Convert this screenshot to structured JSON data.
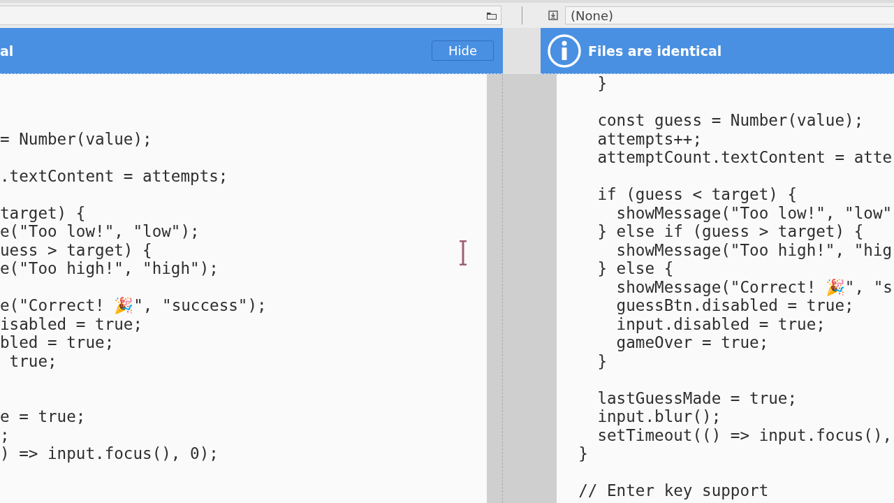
{
  "path_bar": {
    "left_path": {
      "kind": "field"
    },
    "right_path": {
      "value": "(None)"
    }
  },
  "left_pane": {
    "banner": {
      "title": "al",
      "button": "Hide"
    },
    "lines": [
      {
        "kind": "blank"
      },
      {
        "kind": "blank"
      },
      {
        "kind": "blank"
      },
      {
        "kind": "code",
        "text": "= Number(value);"
      },
      {
        "kind": "blank"
      },
      {
        "kind": "code",
        "text": ".textContent = attempts;"
      },
      {
        "kind": "blank"
      },
      {
        "kind": "code",
        "text": "target) {"
      },
      {
        "kind": "code",
        "text": "e(\"Too low!\", \"low\");"
      },
      {
        "kind": "code",
        "text": "uess > target) {"
      },
      {
        "kind": "code",
        "text": "e(\"Too high!\", \"high\");"
      },
      {
        "kind": "blank"
      },
      {
        "kind": "code",
        "text": "e(\"Correct! 🎉\", \"success\");"
      },
      {
        "kind": "code",
        "text": "isabled = true;"
      },
      {
        "kind": "code",
        "text": "bled = true;"
      },
      {
        "kind": "code",
        "text": " true;"
      },
      {
        "kind": "blank"
      },
      {
        "kind": "blank"
      },
      {
        "kind": "code",
        "text": "e = true;"
      },
      {
        "kind": "code",
        "text": ";"
      },
      {
        "kind": "code",
        "text": ") => input.focus(), 0);"
      }
    ]
  },
  "right_pane": {
    "banner": {
      "title": "Files are identical"
    },
    "lines": [
      {
        "kind": "code",
        "text": "    }"
      },
      {
        "kind": "blank"
      },
      {
        "kind": "code",
        "text": "    const guess = Number(value);"
      },
      {
        "kind": "code",
        "text": "    attempts++;"
      },
      {
        "kind": "code",
        "text": "    attemptCount.textContent = atte"
      },
      {
        "kind": "blank"
      },
      {
        "kind": "code",
        "text": "    if (guess < target) {"
      },
      {
        "kind": "code",
        "text": "      showMessage(\"Too low!\", \"low\""
      },
      {
        "kind": "code",
        "text": "    } else if (guess > target) {"
      },
      {
        "kind": "code",
        "text": "      showMessage(\"Too high!\", \"hig"
      },
      {
        "kind": "code",
        "text": "    } else {"
      },
      {
        "kind": "code",
        "text": "      showMessage(\"Correct! 🎉\", \"s"
      },
      {
        "kind": "code",
        "text": "      guessBtn.disabled = true;"
      },
      {
        "kind": "code",
        "text": "      input.disabled = true;"
      },
      {
        "kind": "code",
        "text": "      gameOver = true;"
      },
      {
        "kind": "code",
        "text": "    }"
      },
      {
        "kind": "blank"
      },
      {
        "kind": "code",
        "text": "    lastGuessMade = true;"
      },
      {
        "kind": "code",
        "text": "    input.blur();"
      },
      {
        "kind": "code",
        "text": "    setTimeout(() => input.focus(),"
      },
      {
        "kind": "code",
        "text": "  }"
      },
      {
        "kind": "blank"
      },
      {
        "kind": "code",
        "text": "  // Enter key support"
      }
    ]
  }
}
